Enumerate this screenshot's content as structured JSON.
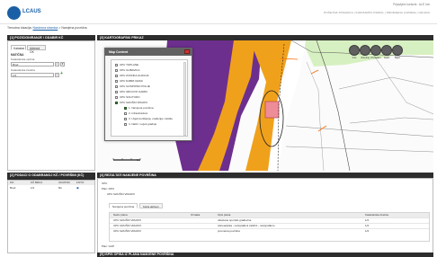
{
  "header": {
    "logo_text": "LCAUS",
    "user_line": "Prijavljeni korisnik : ALE Ivić",
    "nav_items": [
      "POČETNA STRANICA",
      "KORISNIČKI PROFIL",
      "PROMJENA LOZINKE",
      "ODJAVA"
    ],
    "breadcrumb_prefix": "Trenutna lokacija:",
    "breadcrumb_link": "Naslovna stranica",
    "breadcrumb_sep": ">",
    "breadcrumb_current": "Namjena površina"
  },
  "left_panel": {
    "title": "[1] POZICIONIRANJE / ODABIR KČ",
    "tabs": [
      "Katastar",
      "Adresni OK"
    ],
    "section_label": "MATIČNA",
    "field1_label": "Katastarska općina",
    "field1_value": "Brod",
    "field2_label": "Katastarska čestica",
    "field2_value": "1/2"
  },
  "left_bottom": {
    "title": "[2] PODACI O ODABRANOJ KČ / POVRŠINI (KČ)",
    "columns": [
      "KO",
      "KČ BROJ",
      "UKUPNO",
      "FOTO"
    ],
    "row": [
      "Brod",
      "1/2",
      "8m",
      ""
    ]
  },
  "map_panel": {
    "title": "[3] KARTOGRAFSKI PRIKAZ",
    "toolbar": [
      "Info",
      "Zumiraj",
      "Pomakni",
      "Ispiši",
      "Mjeri"
    ],
    "scale_text": "0m",
    "layer_window_title": "Map Content",
    "layers": [
      {
        "name": "UPU TOPLANE",
        "checked": false
      },
      {
        "name": "UPU GUBAVICA",
        "checked": false
      },
      {
        "name": "UPU ZVONKA GUDUJA",
        "checked": false
      },
      {
        "name": "UPU DABRI GRAD",
        "checked": false
      },
      {
        "name": "UPU GOSPOINO POLJE",
        "checked": false
      },
      {
        "name": "UPU SRCOVO GARIFI",
        "checked": false
      },
      {
        "name": "UPU SOLITUDO",
        "checked": false
      },
      {
        "name": "UPU GRUŠKI VRHOVI",
        "checked": true
      },
      {
        "name": "1. Namjena površina",
        "checked": true
      },
      {
        "name": "2. Infrastruktura",
        "checked": false
      },
      {
        "name": "3. Uvjeti korištenja, uređenja i zaštite",
        "checked": false
      },
      {
        "name": "4. Način i uvjeti gradnje",
        "checked": false
      }
    ]
  },
  "bottom_panel": {
    "title": "[4] REZULTATI NAMJENE POVRŠINA",
    "tree": [
      "UPU",
      "Plan: DPU",
      "UPU GRUŠKI VRHOVI"
    ],
    "subtabs": [
      "Namjena površina",
      "Karta aktivan"
    ],
    "table_headers": [
      "Naziv plana",
      "Oznaka",
      "Opis plana",
      "Katastarska čestica"
    ],
    "rows": [
      [
        "UPU GRUŠKI VRHOVI",
        "",
        "otkazane sportski građevina",
        "1/2"
      ],
      [
        "UPU GRUŠKI VRHOVI",
        "",
        "rekreacijska - neizgrađeni zaštitni - neizgrađeno",
        "1/2"
      ],
      [
        "UPU GRUŠKI VRHOVI",
        "",
        "prometna površina",
        "1/2"
      ]
    ],
    "footer_item": "Plan: GUP"
  },
  "footer_panel": {
    "title": "[5] ISPIS OPISA IZ PLANA NAMJENE POVRŠINA"
  },
  "colors": {
    "accent": "#1a5fa6",
    "panel_header": "#2d2d2d",
    "map_orange": "#f0a11c",
    "map_purple": "#6d2f8e",
    "map_green": "#cfe9a8"
  }
}
